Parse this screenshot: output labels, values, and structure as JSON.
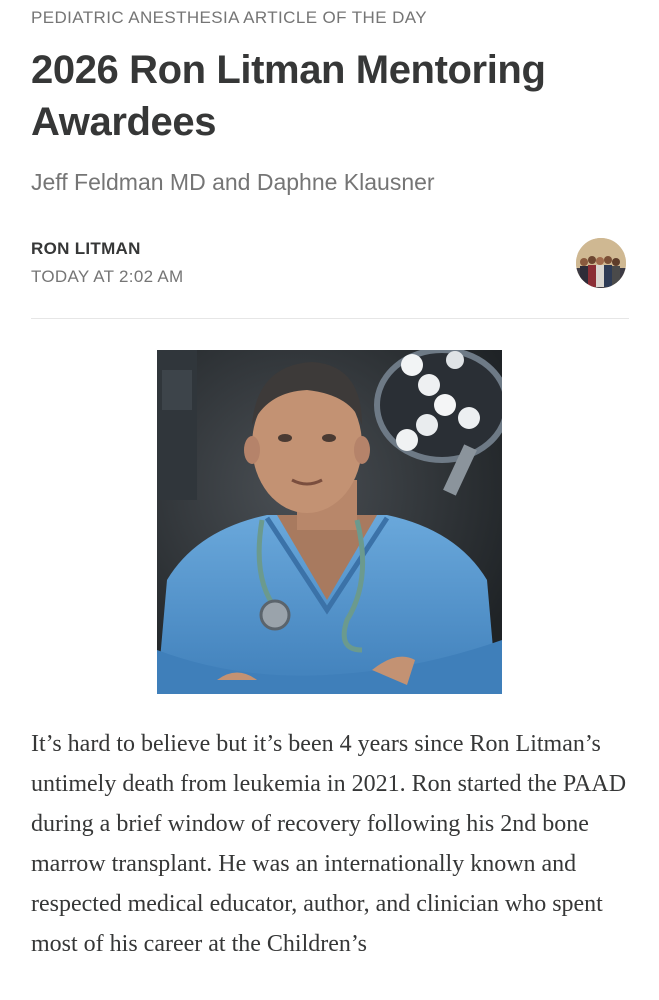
{
  "article": {
    "kicker": "PEDIATRIC ANESTHESIA ARTICLE OF THE DAY",
    "title": "2026 Ron Litman Mentoring Awardees",
    "subtitle": "Jeff Feldman MD and Daphne Klausner",
    "author": "RON LITMAN",
    "date": "TODAY AT 2:02 AM",
    "body": "It’s hard to believe but it’s been 4 years since Ron Litman’s untimely death from leukemia in 2021. Ron started the PAAD during a brief window of recovery following his 2nd bone marrow transplant. He was an internationally known and respected medical educator, author, and clinician who spent most of his career at the Children’s"
  },
  "colors": {
    "text": "#363737",
    "muted": "#757575",
    "scrubs": "#5a9bd4"
  }
}
